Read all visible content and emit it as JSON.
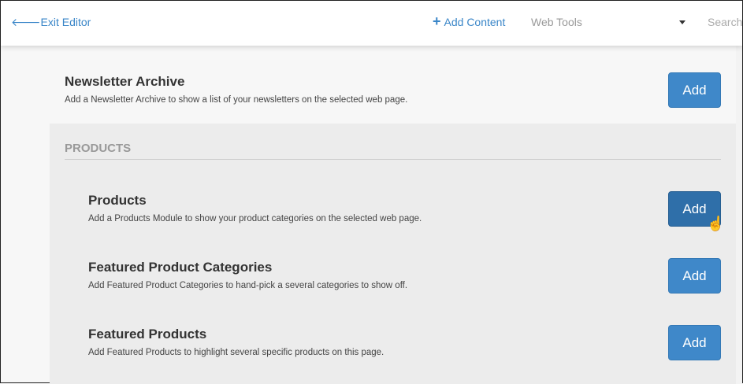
{
  "header": {
    "exit_label": "Exit Editor",
    "add_content_label": "Add Content",
    "web_tools_label": "Web Tools",
    "search_placeholder": "Search"
  },
  "items": [
    {
      "title": "Newsletter Archive",
      "description": "Add a Newsletter Archive to show a list of your newsletters on the selected web page.",
      "button": "Add"
    }
  ],
  "products_section": {
    "heading": "PRODUCTS",
    "items": [
      {
        "title": "Products",
        "description": "Add a Products Module to show your product categories on the selected web page.",
        "button": "Add"
      },
      {
        "title": "Featured Product Categories",
        "description": "Add Featured Product Categories to hand-pick a several categories to show off.",
        "button": "Add"
      },
      {
        "title": "Featured Products",
        "description": "Add Featured Products to highlight several specific products on this page.",
        "button": "Add"
      }
    ]
  },
  "colors": {
    "accent": "#3f88c9",
    "accent_hover": "#2f6fa9"
  }
}
